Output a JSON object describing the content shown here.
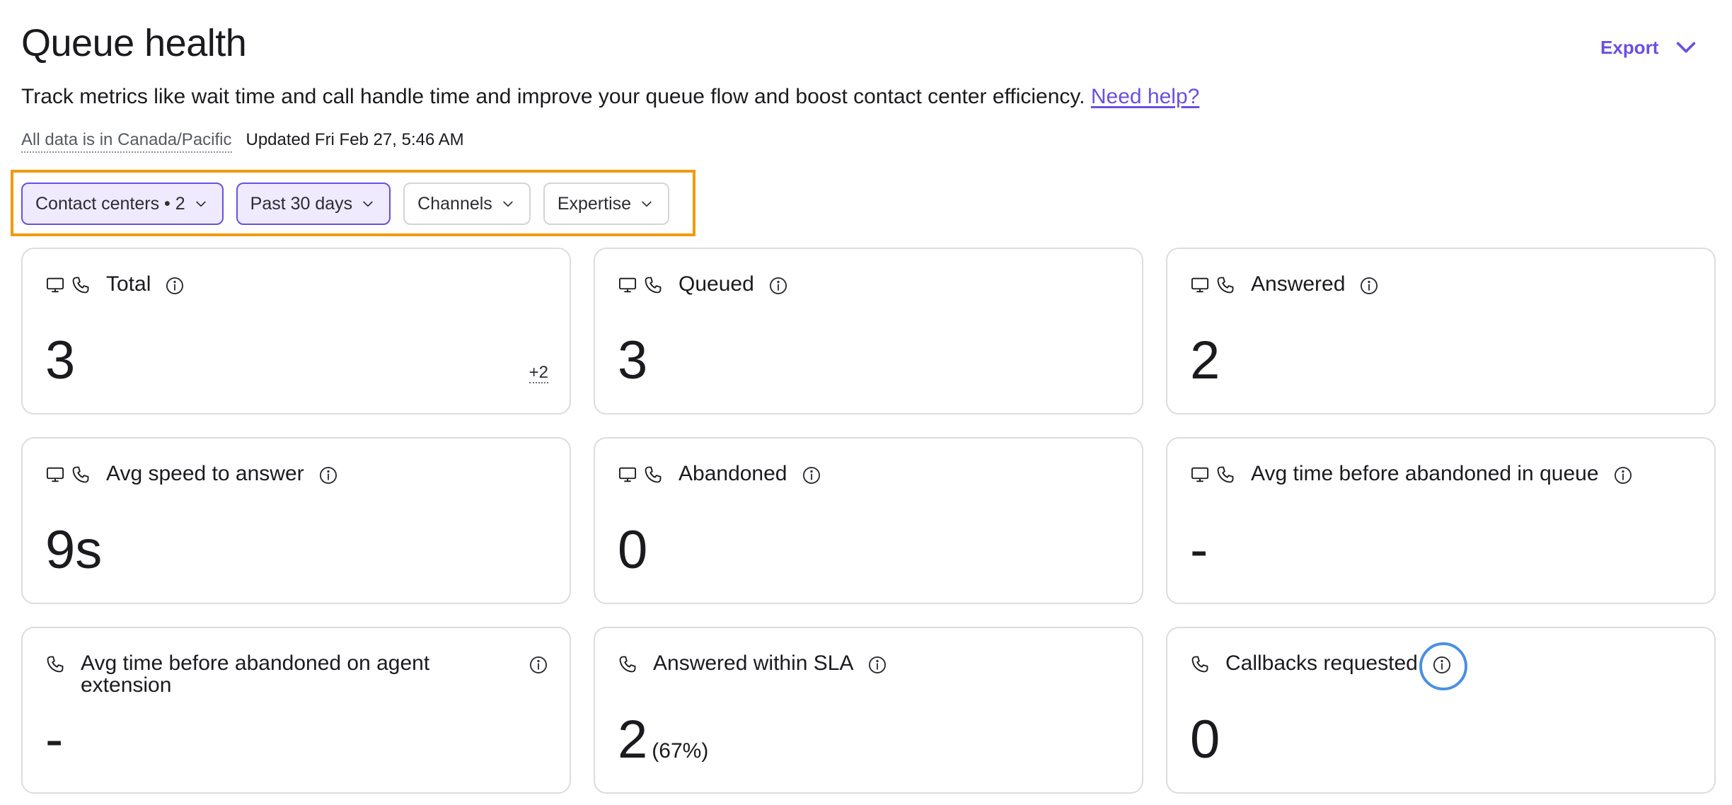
{
  "page": {
    "title": "Queue health",
    "export_label": "Export",
    "description": "Track metrics like wait time and call handle time and improve your queue flow and boost contact center efficiency.",
    "help_link": "Need help?",
    "timezone_note": "All data is in Canada/Pacific",
    "updated": "Updated Fri Feb 27, 5:46 AM"
  },
  "filters": [
    {
      "label": "Contact centers • 2",
      "active": true
    },
    {
      "label": "Past 30 days",
      "active": true
    },
    {
      "label": "Channels",
      "active": false
    },
    {
      "label": "Expertise",
      "active": false
    }
  ],
  "cards": [
    {
      "label": "Total",
      "value": "3",
      "delta": "+2",
      "icons": [
        "monitor-icon",
        "phone-icon"
      ]
    },
    {
      "label": "Queued",
      "value": "3",
      "icons": [
        "monitor-icon",
        "phone-icon"
      ]
    },
    {
      "label": "Answered",
      "value": "2",
      "icons": [
        "monitor-icon",
        "phone-icon"
      ]
    },
    {
      "label": "Avg speed to answer",
      "value": "9s",
      "icons": [
        "monitor-icon",
        "phone-icon"
      ]
    },
    {
      "label": "Abandoned",
      "value": "0",
      "icons": [
        "monitor-icon",
        "phone-icon"
      ]
    },
    {
      "label": "Avg time before abandoned in queue",
      "value": "-",
      "icons": [
        "monitor-icon",
        "phone-icon"
      ]
    },
    {
      "label": "Avg time before abandoned on agent extension",
      "value": "-",
      "icons": [
        "phone-icon"
      ]
    },
    {
      "label": "Answered within SLA",
      "value": "2",
      "value_suffix": "(67%)",
      "icons": [
        "phone-icon"
      ]
    },
    {
      "label": "Callbacks requested",
      "value": "0",
      "icons": [
        "phone-icon"
      ]
    }
  ],
  "colors": {
    "accent": "#6b4fe0",
    "highlight_outline": "#f39a10",
    "focus_ring": "#4a90e2"
  }
}
